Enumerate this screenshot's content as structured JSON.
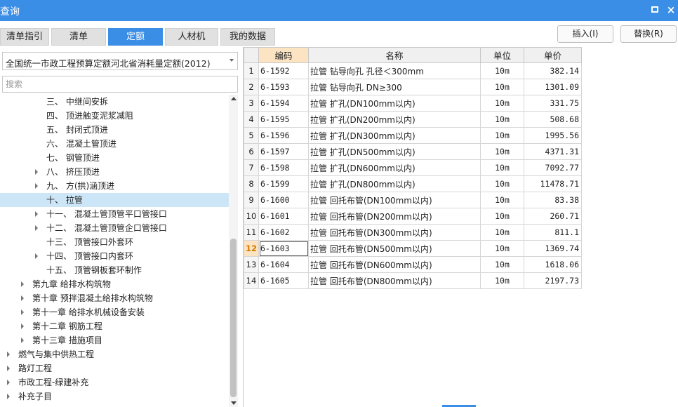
{
  "window": {
    "title": "查询",
    "maximize_icon": "maximize-icon",
    "close_icon": "close-icon",
    "close_glyph": "×"
  },
  "tabs": [
    {
      "label": "清单指引",
      "active": false
    },
    {
      "label": "清单",
      "active": false
    },
    {
      "label": "定额",
      "active": true
    },
    {
      "label": "人材机",
      "active": false
    },
    {
      "label": "我的数据",
      "active": false
    }
  ],
  "toolbar": {
    "insert_label": "插入(I)",
    "replace_label": "替换(R)"
  },
  "library_select": {
    "value": "全国统一市政工程预算定额河北省消耗量定额(2012)"
  },
  "search": {
    "placeholder": "搜索",
    "value": ""
  },
  "tree": {
    "items": [
      {
        "label": "三、 中继间安拆",
        "expandable": false,
        "selected": false
      },
      {
        "label": "四、 顶进触变泥浆减阻",
        "expandable": false,
        "selected": false
      },
      {
        "label": "五、 封闭式顶进",
        "expandable": false,
        "selected": false
      },
      {
        "label": "六、 混凝土管顶进",
        "expandable": false,
        "selected": false
      },
      {
        "label": "七、 钢管顶进",
        "expandable": false,
        "selected": false
      },
      {
        "label": "八、 挤压顶进",
        "expandable": true,
        "selected": false
      },
      {
        "label": "九、 方(拱)涵顶进",
        "expandable": true,
        "selected": false
      },
      {
        "label": "十、 拉管",
        "expandable": false,
        "selected": true
      },
      {
        "label": "十一、 混凝土管顶管平口管接口",
        "expandable": true,
        "selected": false
      },
      {
        "label": "十二、 混凝土管顶管企口管接口",
        "expandable": true,
        "selected": false
      },
      {
        "label": "十三、 顶管接口外套环",
        "expandable": false,
        "selected": false
      },
      {
        "label": "十四、 顶管接口内套环",
        "expandable": true,
        "selected": false
      },
      {
        "label": "十五、 顶管钢板套环制作",
        "expandable": false,
        "selected": false
      },
      {
        "label": "第九章 给排水构筑物",
        "expandable": true,
        "selected": false
      },
      {
        "label": "第十章 预拌混凝土给排水构筑物",
        "expandable": true,
        "selected": false
      },
      {
        "label": "第十一章 给排水机械设备安装",
        "expandable": true,
        "selected": false
      },
      {
        "label": "第十二章 钢筋工程",
        "expandable": true,
        "selected": false
      },
      {
        "label": "第十三章 措施项目",
        "expandable": true,
        "selected": false
      },
      {
        "label": "燃气与集中供热工程",
        "expandable": true,
        "selected": false
      },
      {
        "label": "路灯工程",
        "expandable": true,
        "selected": false
      },
      {
        "label": "市政工程-绿建补充",
        "expandable": true,
        "selected": false
      },
      {
        "label": "补充子目",
        "expandable": true,
        "selected": false
      }
    ]
  },
  "grid": {
    "columns": {
      "code": "编码",
      "name": "名称",
      "unit": "单位",
      "price": "单价"
    },
    "current_row": 12,
    "rows": [
      {
        "n": "1",
        "code": "6-1592",
        "name": "拉管 钻导向孔 孔径＜300mm",
        "unit": "10m",
        "price": "382.14"
      },
      {
        "n": "2",
        "code": "6-1593",
        "name": "拉管 钻导向孔 DN≥300",
        "unit": "10m",
        "price": "1301.09"
      },
      {
        "n": "3",
        "code": "6-1594",
        "name": "拉管 扩孔(DN100mm以内)",
        "unit": "10m",
        "price": "331.75"
      },
      {
        "n": "4",
        "code": "6-1595",
        "name": "拉管 扩孔(DN200mm以内)",
        "unit": "10m",
        "price": "508.68"
      },
      {
        "n": "5",
        "code": "6-1596",
        "name": "拉管 扩孔(DN300mm以内)",
        "unit": "10m",
        "price": "1995.56"
      },
      {
        "n": "6",
        "code": "6-1597",
        "name": "拉管 扩孔(DN500mm以内)",
        "unit": "10m",
        "price": "4371.31"
      },
      {
        "n": "7",
        "code": "6-1598",
        "name": "拉管 扩孔(DN600mm以内)",
        "unit": "10m",
        "price": "7092.77"
      },
      {
        "n": "8",
        "code": "6-1599",
        "name": "拉管 扩孔(DN800mm以内)",
        "unit": "10m",
        "price": "11478.71"
      },
      {
        "n": "9",
        "code": "6-1600",
        "name": "拉管 回托布管(DN100mm以内)",
        "unit": "10m",
        "price": "83.38"
      },
      {
        "n": "10",
        "code": "6-1601",
        "name": "拉管 回托布管(DN200mm以内)",
        "unit": "10m",
        "price": "260.71"
      },
      {
        "n": "11",
        "code": "6-1602",
        "name": "拉管 回托布管(DN300mm以内)",
        "unit": "10m",
        "price": "811.1"
      },
      {
        "n": "12",
        "code": "6-1603",
        "name": "拉管 回托布管(DN500mm以内)",
        "unit": "10m",
        "price": "1369.74"
      },
      {
        "n": "13",
        "code": "6-1604",
        "name": "拉管 回托布管(DN600mm以内)",
        "unit": "10m",
        "price": "1618.06"
      },
      {
        "n": "14",
        "code": "6-1605",
        "name": "拉管 回托布管(DN800mm以内)",
        "unit": "10m",
        "price": "2197.73"
      }
    ]
  },
  "colors": {
    "accent": "#3a8ee6",
    "selected_tree": "#cde6f7",
    "current_header": "#fce4c3",
    "current_row_number": "#d07a00"
  }
}
